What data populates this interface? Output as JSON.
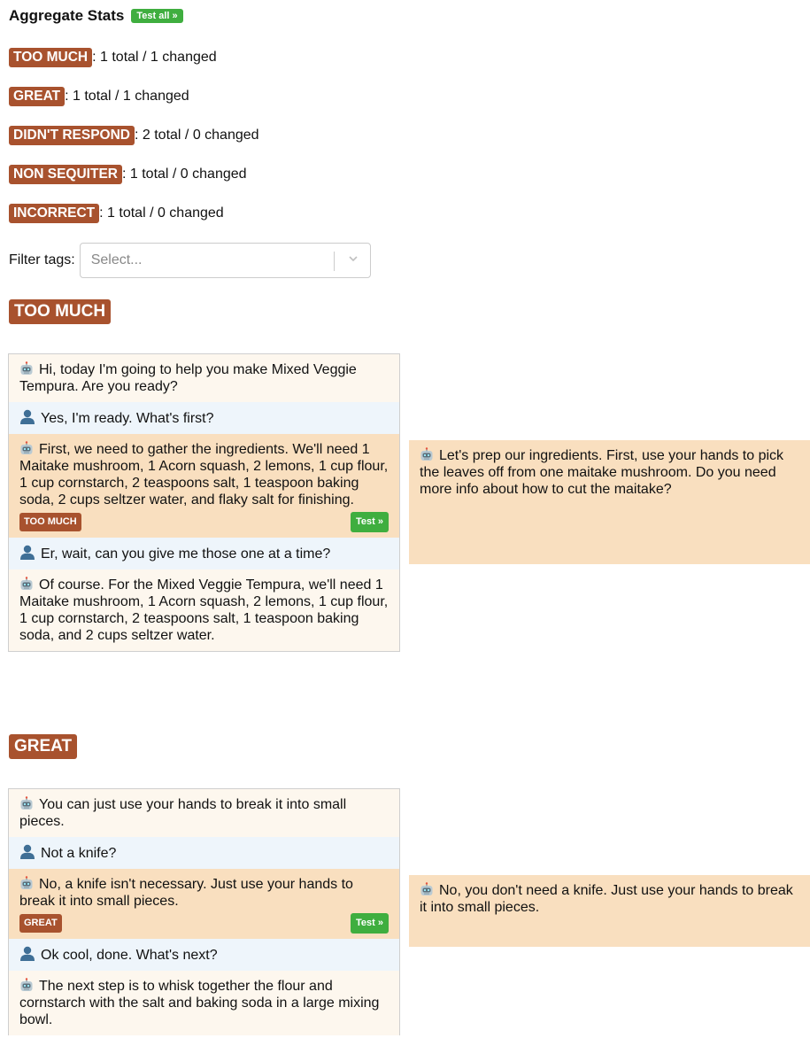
{
  "header": {
    "title": "Aggregate Stats",
    "test_all": "Test all »"
  },
  "stats": [
    {
      "tag": "TOO MUCH",
      "text": ": 1 total / 1 changed"
    },
    {
      "tag": "GREAT",
      "text": ": 1 total / 1 changed"
    },
    {
      "tag": "DIDN'T RESPOND",
      "text": ": 2 total / 0 changed"
    },
    {
      "tag": "NON SEQUITER",
      "text": ": 1 total / 0 changed"
    },
    {
      "tag": "INCORRECT",
      "text": ": 1 total / 0 changed"
    }
  ],
  "filter": {
    "label": "Filter tags:",
    "placeholder": "Select..."
  },
  "sections": [
    {
      "tag": "TOO MUCH",
      "messages": [
        {
          "role": "bot",
          "text": "Hi, today I'm going to help you make Mixed Veggie Tempura. Are you ready?"
        },
        {
          "role": "user",
          "text": "Yes, I'm ready. What's first?"
        },
        {
          "role": "bot",
          "text": "First, we need to gather the ingredients. We'll need 1 Maitake mushroom, 1 Acorn squash, 2 lemons, 1 cup flour, 1 cup cornstarch, 2 teaspoons salt, 1 teaspoon baking soda, 2 cups seltzer water, and flaky salt for finishing.",
          "tag": "TOO MUCH",
          "test": "Test »"
        },
        {
          "role": "user",
          "text": "Er, wait, can you give me those one at a time?"
        },
        {
          "role": "bot",
          "text": "Of course. For the Mixed Veggie Tempura, we'll need 1 Maitake mushroom, 1 Acorn squash, 2 lemons, 1 cup flour, 1 cup cornstarch, 2 teaspoons salt, 1 teaspoon baking soda, and 2 cups seltzer water."
        }
      ],
      "alternative": "Let's prep our ingredients. First, use your hands to pick the leaves off from one maitake mushroom. Do you need more info about how to cut the maitake?"
    },
    {
      "tag": "GREAT",
      "messages": [
        {
          "role": "bot",
          "text": "You can just use your hands to break it into small pieces."
        },
        {
          "role": "user",
          "text": "Not a knife?"
        },
        {
          "role": "bot",
          "text": "No, a knife isn't necessary. Just use your hands to break it into small pieces.",
          "tag": "GREAT",
          "test": "Test »"
        },
        {
          "role": "user",
          "text": "Ok cool, done. What's next?"
        },
        {
          "role": "bot",
          "text": "The next step is to whisk together the flour and cornstarch with the salt and baking soda in a large mixing bowl."
        }
      ],
      "alternative": "No, you don't need a knife. Just use your hands to break it into small pieces."
    }
  ]
}
